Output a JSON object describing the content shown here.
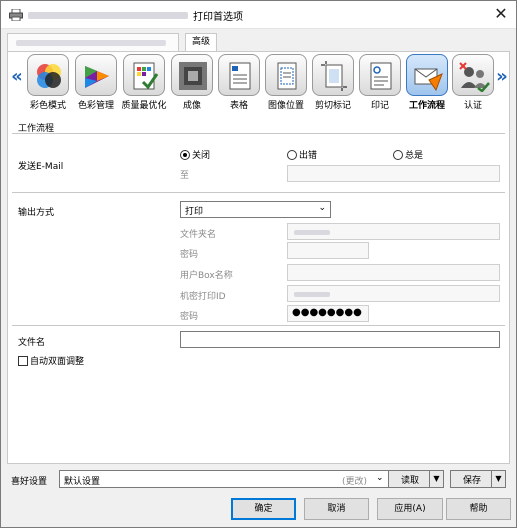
{
  "window": {
    "title": "打印首选项",
    "close_glyph": "✕"
  },
  "tabs": [
    {
      "label": ""
    },
    {
      "label": "高级"
    }
  ],
  "toolbar": {
    "left_arrow": "«",
    "right_arrow": "»",
    "items": [
      {
        "label": "彩色模式",
        "icon": "color-mode-icon"
      },
      {
        "label": "色彩管理",
        "icon": "color-management-icon"
      },
      {
        "label": "质量最优化",
        "icon": "quality-optimize-icon"
      },
      {
        "label": "成像",
        "icon": "imaging-icon"
      },
      {
        "label": "表格",
        "icon": "form-icon"
      },
      {
        "label": "图像位置",
        "icon": "image-position-icon"
      },
      {
        "label": "剪切标记",
        "icon": "crop-marks-icon"
      },
      {
        "label": "印记",
        "icon": "stamp-icon"
      },
      {
        "label": "工作流程",
        "icon": "workflow-icon",
        "active": true
      },
      {
        "label": "认证",
        "icon": "authentication-icon"
      }
    ]
  },
  "workflow": {
    "section_title": "工作流程",
    "send_email": {
      "label": "发送E-Mail",
      "options": [
        "关闭",
        "出错",
        "总是"
      ],
      "selected": "关闭",
      "to_label": "至",
      "to_value": ""
    },
    "output": {
      "label": "输出方式",
      "selected": "打印",
      "dropdown_glyph": "⌄",
      "folder_name_label": "文件夹名",
      "password_label": "密码",
      "user_box_label": "用户Box名称",
      "secure_id_label": "机密打印ID",
      "secure_password_label": "密码",
      "secure_password_value": "●●●●●●●●"
    },
    "file_name": {
      "label": "文件名",
      "value": ""
    },
    "auto_duplex": {
      "label": "自动双面调整",
      "checked": false
    }
  },
  "favorites": {
    "label": "喜好设置",
    "value": "默认设置",
    "change_hint": "(更改)",
    "dropdown_glyph": "⌄",
    "load_label": "读取",
    "save_label": "保存",
    "split_glyph": "▼"
  },
  "buttons": {
    "ok": "确定",
    "cancel": "取消",
    "apply": "应用(A)",
    "help": "帮助"
  }
}
